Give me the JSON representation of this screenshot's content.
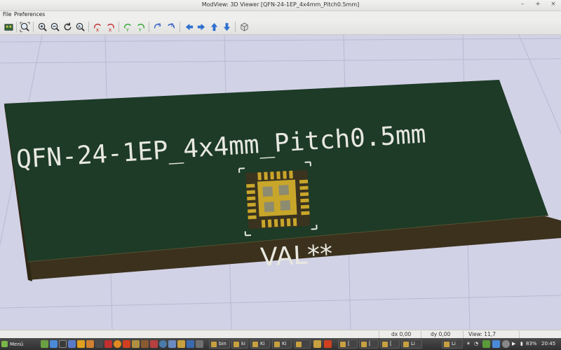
{
  "window": {
    "title": "ModView: 3D Viewer [QFN-24-1EP_4x4mm_Pitch0.5mm]",
    "controls": [
      "–",
      "+",
      "×"
    ]
  },
  "menu": [
    "File",
    "Preferences"
  ],
  "toolbar": {
    "icons": [
      "reload-icon",
      "zoom-fit-icon",
      "zoom-in-icon",
      "zoom-out-icon",
      "redraw-icon",
      "zoom-auto-icon",
      "rotate-x-cw-icon",
      "rotate-x-ccw-icon",
      "rotate-y-cw-icon",
      "rotate-y-ccw-icon",
      "rotate-z-cw-icon",
      "rotate-z-ccw-icon",
      "move-left-icon",
      "move-right-icon",
      "move-up-icon",
      "move-down-icon",
      "ortho-icon"
    ]
  },
  "board": {
    "silk_title": "QFN-24-1EP_4x4mm_Pitch0.5mm",
    "value_label": "VAL**",
    "colors": {
      "soldermask": "#1b3a26",
      "edge": "#3f3420",
      "pad": "#c8a62a",
      "silk": "#e8e8e0",
      "background": "#d2d2e6"
    }
  },
  "status": {
    "dx": "dx 0,00",
    "dy": "dy 0,00",
    "view": "View: 11,7"
  },
  "taskbar": {
    "menu_label": "Menü",
    "tasks": [
      "bin",
      "ki",
      "Ki",
      "Ki",
      "",
      "[",
      "[",
      "[",
      "Li",
      "Li"
    ],
    "battery": "83%",
    "clock": "20:45"
  }
}
